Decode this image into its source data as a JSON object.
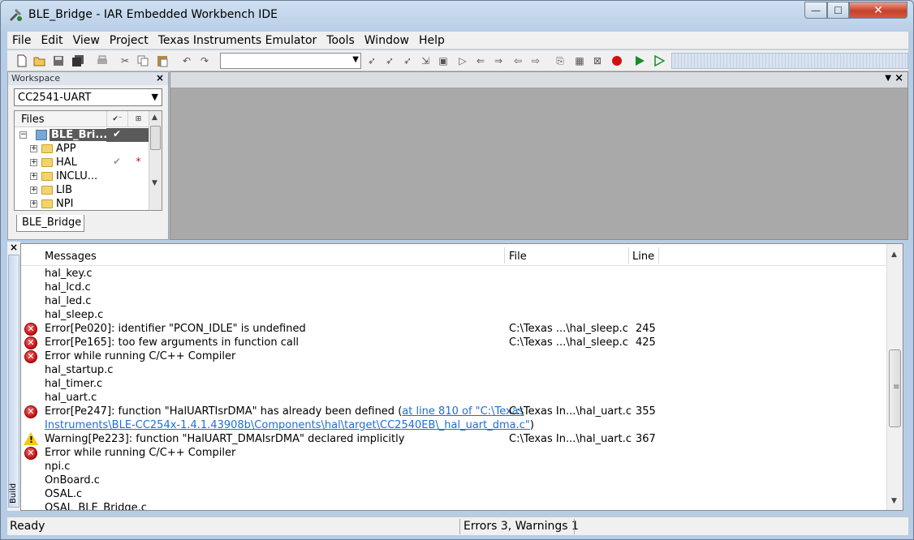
{
  "window": {
    "title": "BLE_Bridge - IAR Embedded Workbench IDE",
    "close_glyph": "✕",
    "minimize_glyph": "—",
    "maximize_glyph": "☐"
  },
  "menu": [
    "File",
    "Edit",
    "View",
    "Project",
    "Texas Instruments Emulator",
    "Tools",
    "Window",
    "Help"
  ],
  "toolbar": {
    "icons": [
      "new-file-icon",
      "open-icon",
      "save-icon",
      "save-all-icon",
      "print-icon",
      "cut-icon",
      "copy-icon",
      "paste-icon",
      "undo-icon",
      "redo-icon"
    ],
    "search_value": "",
    "right_icons": [
      "find-icon",
      "find-next-icon",
      "find-prev-icon",
      "replace-icon",
      "goto-icon",
      "bookmark-icon",
      "next-bookmark-icon",
      "prev-bookmark-icon",
      "navigate-back-icon",
      "navigate-forward-icon",
      "compile-icon",
      "make-icon",
      "stop-build-icon",
      "breakpoint-icon",
      "debug-icon",
      "debug-without-download-icon"
    ]
  },
  "workspace": {
    "title": "Workspace",
    "configuration": "CC2541-UART",
    "files_header": "Files",
    "tab_label": "BLE_Bridge",
    "tree": [
      {
        "label": "BLE_Bri...",
        "check": "✔",
        "star": "",
        "root": true
      },
      {
        "label": "APP",
        "check": "",
        "star": ""
      },
      {
        "label": "HAL",
        "check": "✔",
        "star": "*"
      },
      {
        "label": "INCLU...",
        "check": "",
        "star": ""
      },
      {
        "label": "LIB",
        "check": "",
        "star": ""
      },
      {
        "label": "NPI",
        "check": "",
        "star": ""
      }
    ]
  },
  "build": {
    "tab_label": "Build",
    "columns": {
      "messages": "Messages",
      "file": "File",
      "line": "Line"
    },
    "rows": [
      {
        "type": "none",
        "text": "hal_key.c",
        "file": "",
        "line": ""
      },
      {
        "type": "none",
        "text": "hal_lcd.c",
        "file": "",
        "line": ""
      },
      {
        "type": "none",
        "text": "hal_led.c",
        "file": "",
        "line": ""
      },
      {
        "type": "none",
        "text": "hal_sleep.c",
        "file": "",
        "line": ""
      },
      {
        "type": "error",
        "text": "Error[Pe020]: identifier \"PCON_IDLE\" is undefined",
        "file": "C:\\Texas ...\\hal_sleep.c",
        "line": "245"
      },
      {
        "type": "error",
        "text": "Error[Pe165]: too few arguments in function call",
        "file": "C:\\Texas ...\\hal_sleep.c",
        "line": "425"
      },
      {
        "type": "error",
        "text": "Error while running C/C++ Compiler",
        "file": "",
        "line": ""
      },
      {
        "type": "none",
        "text": "hal_startup.c",
        "file": "",
        "line": ""
      },
      {
        "type": "none",
        "text": "hal_timer.c",
        "file": "",
        "line": ""
      },
      {
        "type": "none",
        "text": "hal_uart.c",
        "file": "",
        "line": ""
      },
      {
        "type": "error",
        "text": "Error[Pe247]: function \"HalUARTIsrDMA\" has already been defined (",
        "link": "at line 810 of \"C:\\Texas",
        "file": "C:\\Texas In...\\hal_uart.c",
        "line": "355"
      },
      {
        "type": "continuation",
        "link": "Instruments\\BLE-CC254x-1.4.1.43908b\\Components\\hal\\target\\CC2540EB\\_hal_uart_dma.c\"",
        "text": ")",
        "file": "",
        "line": ""
      },
      {
        "type": "warning",
        "text": "Warning[Pe223]: function \"HalUART_DMAIsrDMA\" declared implicitly",
        "file": "C:\\Texas In...\\hal_uart.c",
        "line": "367"
      },
      {
        "type": "error",
        "text": "Error while running C/C++ Compiler",
        "file": "",
        "line": ""
      },
      {
        "type": "none",
        "text": "npi.c",
        "file": "",
        "line": ""
      },
      {
        "type": "none",
        "text": "OnBoard.c",
        "file": "",
        "line": ""
      },
      {
        "type": "none",
        "text": "OSAL.c",
        "file": "",
        "line": ""
      },
      {
        "type": "none",
        "text": "OSAL_BLE_Bridge.c",
        "file": "",
        "line": ""
      }
    ]
  },
  "status": {
    "left": "Ready",
    "errors": "Errors 3, Warnings 1"
  },
  "colors": {
    "error": "#c30f0f",
    "warning": "#f3c916",
    "link": "#1a6fd6"
  }
}
